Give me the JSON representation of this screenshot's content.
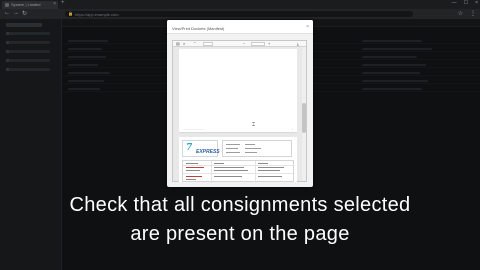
{
  "browser": {
    "tab_title": "System | Limited",
    "tab_close": "×",
    "new_tab": "+",
    "url": "https://app.example.com",
    "url_lock": "🔒",
    "nav_back": "←",
    "nav_forward": "→",
    "nav_reload": "↻",
    "window_controls": [
      "—",
      "☐",
      "×"
    ],
    "toolbar_icons": [
      "☆",
      "⋮"
    ]
  },
  "modal": {
    "title": "View/Print Dockets (Manifest)",
    "close_icon": "×"
  },
  "pdf_viewer": {
    "toolbar": {
      "sidebar_icon": "▤",
      "search_icon": "⌕",
      "prev_icon": "⌃",
      "zoom_out_icon": "−",
      "zoom_in_icon": "+",
      "download_icon": "⤓"
    },
    "page1_footer_left": "-------------------------------",
    "page1_footer_right": "1",
    "page2": {
      "logo_mark": "7",
      "logo_text": "EXPRESS"
    }
  },
  "caption": {
    "line1": "Check that all consignments selected",
    "line2": "are present on the page"
  },
  "colors": {
    "accent_teal": "#2fa4b9",
    "logo_blue": "#2d5fa0",
    "caption_text": "#ffffff"
  }
}
